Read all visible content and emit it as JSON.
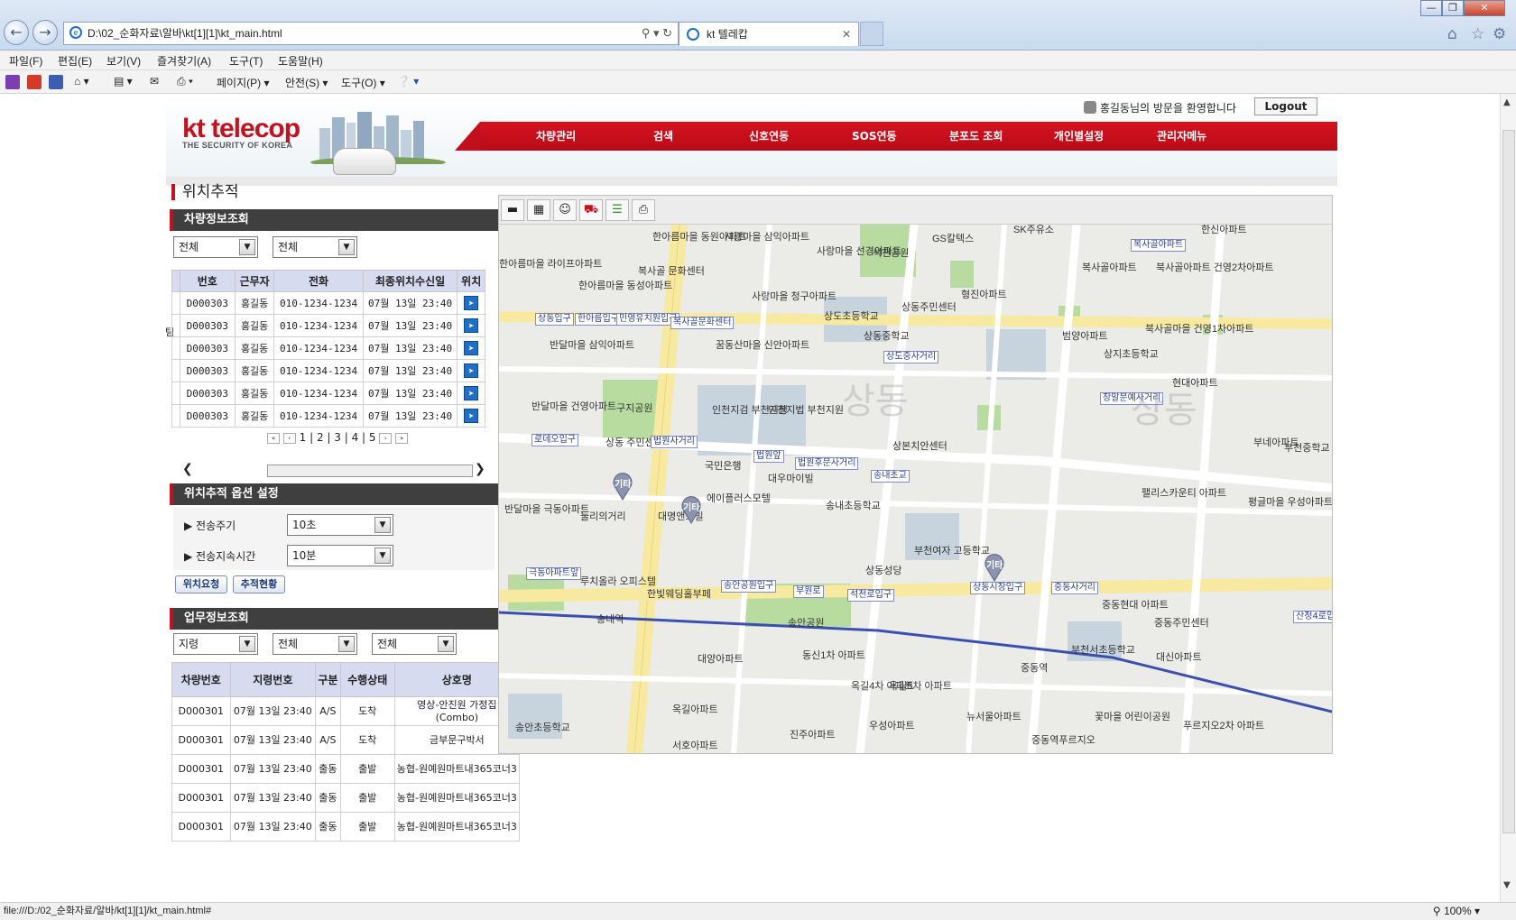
{
  "browser": {
    "address": "D:\\02_순화자료\\알바\\kt[1][1]\\kt_main.html",
    "tab_title": "kt 텔레캅",
    "menu": [
      "파일(F)",
      "편집(E)",
      "보기(V)",
      "즐겨찾기(A)",
      "도구(T)",
      "도움말(H)"
    ],
    "commands": {
      "page": "페이지(P)",
      "safety": "안전(S)",
      "tools": "도구(O)"
    },
    "status_url": "file:///D:/02_순화자료/알바/kt[1][1]/kt_main.html#",
    "zoom": "100%"
  },
  "site": {
    "logo_main": "kt telecop",
    "logo_sub": "THE SECURITY OF KOREA",
    "welcome_name": "홍길동",
    "welcome_text": "님의 방문을 환영합니다",
    "logout": "Logout",
    "nav": [
      "차량관리",
      "검색",
      "신호연동",
      "SOS연동",
      "분포도 조회",
      "개인별설정",
      "관리자메뉴"
    ],
    "page_title": "위치추적"
  },
  "vehicle_panel": {
    "title": "차량정보조회",
    "filter1": "전체",
    "filter2": "전체",
    "columns": [
      "번호",
      "근무자",
      "전화",
      "최종위치수신일",
      "위치"
    ],
    "rows": [
      [
        "D000303",
        "홍길동",
        "010-1234-1234",
        "07월 13일 23:40"
      ],
      [
        "D000303",
        "홍길동",
        "010-1234-1234",
        "07월 13일 23:40"
      ],
      [
        "D000303",
        "홍길동",
        "010-1234-1234",
        "07월 13일 23:40"
      ],
      [
        "D000303",
        "홍길동",
        "010-1234-1234",
        "07월 13일 23:40"
      ],
      [
        "D000303",
        "홍길동",
        "010-1234-1234",
        "07월 13일 23:40"
      ],
      [
        "D000303",
        "홍길동",
        "010-1234-1234",
        "07월 13일 23:40"
      ]
    ],
    "row_prefix": "팀",
    "pages": [
      "1",
      "2",
      "3",
      "4",
      "5"
    ]
  },
  "options_panel": {
    "title": "위치추적 옵션 설정",
    "period_label": "전송주기",
    "period_value": "10초",
    "duration_label": "전송지속시간",
    "duration_value": "10분",
    "request_btn": "위치요청",
    "status_btn": "추적현황"
  },
  "work_panel": {
    "title": "업무정보조회",
    "filter1": "지령",
    "filter2": "전체",
    "filter3": "전체",
    "columns": [
      "차량번호",
      "지령번호",
      "구분",
      "수행상태",
      "상호명"
    ],
    "rows": [
      [
        "D000301",
        "07월 13일 23:40",
        "A/S",
        "도착",
        "영상-안진원 가정집 (Combo)"
      ],
      [
        "D000301",
        "07월 13일 23:40",
        "A/S",
        "도착",
        "금부문구박서"
      ],
      [
        "D000301",
        "07월 13일 23:40",
        "출동",
        "출발",
        "농협-원예원마트내365코너3"
      ],
      [
        "D000301",
        "07월 13일 23:40",
        "출동",
        "출발",
        "농협-원예원마트내365코너3"
      ],
      [
        "D000301",
        "07월 13일 23:40",
        "출동",
        "출발",
        "농협-원예원마트내365코너3"
      ]
    ]
  },
  "map": {
    "labels": [
      "한아름마을 동원아파트",
      "사랑마을 삼익아파트",
      "사랑마을 선경아파트",
      "석천공원",
      "GS칼텍스",
      "SK주유소",
      "한신아파트",
      "복사골아파트",
      "북사골아파트 건영2차아파트",
      "한아름마을 라이프아파트",
      "한아름마을 동성아파트",
      "복사골 문화센터",
      "사랑마을 청구아파트",
      "상도초등학교",
      "상동주민센터",
      "형진아파트",
      "반달마을 삼익아파트",
      "꿈동산마을 신안아파트",
      "상동중학교",
      "범양아파트",
      "북사골마을 건영1차아파트",
      "상지초등학교",
      "현대아파트",
      "반달마을 건영아파트",
      "구지공원",
      "인천지검 부천지청",
      "인천지법 부천지원",
      "상동 주민센터",
      "국민은행",
      "대우마이빌",
      "상본치안센터",
      "부네아파트",
      "송내초등학교",
      "반달마을 극동아파트",
      "둘리의거리",
      "대명앤스빌",
      "에이플러스모텔",
      "평글마을 우성아파트",
      "상동성당",
      "부천여자 고등학교",
      "루치올라 오피스텔",
      "한빛웨딩홀부페",
      "송안공원",
      "중동현대 아파트",
      "중동주민센터",
      "대양아파트",
      "동신1차 아파트",
      "부천서초등학교",
      "대신아파트",
      "옥길4차 아파트",
      "옥길5차 아파트",
      "꽃마을 어린이공원",
      "송안초등학교",
      "옥길아파트",
      "우성아파트",
      "진주아파트",
      "뉴서울아파트",
      "중동역푸르지오",
      "푸르지오2차 아파트",
      "서호아파트",
      "송내역",
      "중동역",
      "팰리스카운티 아파트",
      "부천중학교"
    ],
    "bus_stops": [
      "복사골아파트",
      "상동입구",
      "한아름입구",
      "민영유치원입구",
      "복사골문화센터",
      "상도중사거리",
      "장말문예사거리",
      "로데오입구",
      "법원사거리",
      "법원앞",
      "법원후문사거리",
      "송내초교",
      "극동아파트앞",
      "송안공원입구",
      "부원로",
      "석천로입구",
      "상동시장입구",
      "중동사거리",
      "산정4로입구"
    ],
    "markers": [
      "기타",
      "기타",
      "기타"
    ],
    "watermark": "상동"
  }
}
